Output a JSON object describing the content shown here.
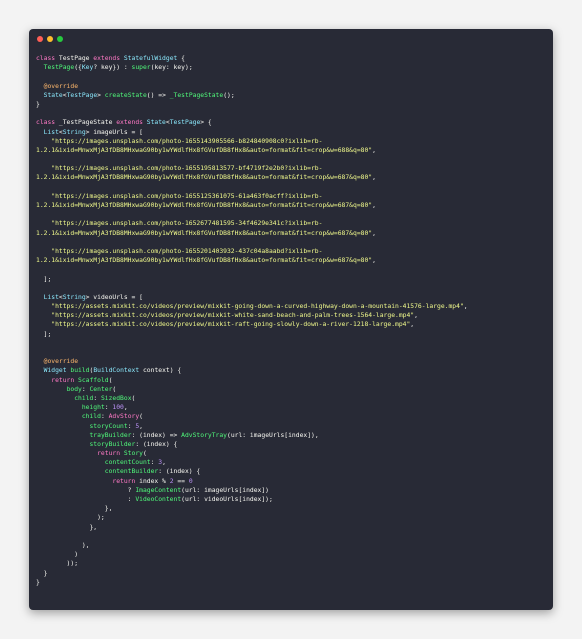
{
  "window": {
    "colors": {
      "background": "#282a36",
      "close": "#ff5f56",
      "minimize": "#ffbd2e",
      "maximize": "#27c93f"
    },
    "syntax_colors": {
      "keyword": "#ff79c6",
      "type": "#8be9fd",
      "function": "#50fa7b",
      "string": "#f1fa8c",
      "number": "#bd93f9",
      "annotation": "#ffb86c",
      "plain": "#f8f8f2"
    }
  },
  "code": {
    "lines": [
      [
        [
          "kw",
          "class "
        ],
        [
          "pl",
          "TestPage "
        ],
        [
          "kw",
          "extends "
        ],
        [
          "ty",
          "StatefulWidget"
        ],
        [
          "pl",
          " {"
        ]
      ],
      [
        [
          "pl",
          "  "
        ],
        [
          "fn",
          "TestPage"
        ],
        [
          "pl",
          "({"
        ],
        [
          "ty",
          "Key"
        ],
        [
          "pl",
          "? key}) : "
        ],
        [
          "fn",
          "super"
        ],
        [
          "pl",
          "(key: key);"
        ]
      ],
      [
        [
          "pl",
          ""
        ]
      ],
      [
        [
          "pl",
          "  "
        ],
        [
          "an",
          "@override"
        ]
      ],
      [
        [
          "pl",
          "  "
        ],
        [
          "ty",
          "State"
        ],
        [
          "pl",
          "<"
        ],
        [
          "ty",
          "TestPage"
        ],
        [
          "pl",
          "> "
        ],
        [
          "fn",
          "createState"
        ],
        [
          "pl",
          "() => "
        ],
        [
          "fn",
          "_TestPageState"
        ],
        [
          "pl",
          "();"
        ]
      ],
      [
        [
          "pl",
          "}"
        ]
      ],
      [
        [
          "pl",
          ""
        ]
      ],
      [
        [
          "kw",
          "class "
        ],
        [
          "pl",
          "_TestPageState "
        ],
        [
          "kw",
          "extends "
        ],
        [
          "ty",
          "State"
        ],
        [
          "pl",
          "<"
        ],
        [
          "ty",
          "TestPage"
        ],
        [
          "pl",
          "> {"
        ]
      ],
      [
        [
          "pl",
          "  "
        ],
        [
          "ty",
          "List"
        ],
        [
          "pl",
          "<"
        ],
        [
          "ty",
          "String"
        ],
        [
          "pl",
          "> imageUrls = ["
        ]
      ],
      [
        [
          "pl",
          "    "
        ],
        [
          "st",
          "\"https://images.unsplash.com/photo-1655143905566-b824840908c0?ixlib=rb-"
        ]
      ],
      [
        [
          "st",
          "1.2.1&ixid=MnwxMjA3fDB8MHxwaG90by1wYWdlfHx8fGVufDB8fHx8&auto=format&fit=crop&w=688&q=80\""
        ],
        [
          "pl",
          ","
        ]
      ],
      [
        [
          "pl",
          ""
        ]
      ],
      [
        [
          "pl",
          "    "
        ],
        [
          "st",
          "\"https://images.unsplash.com/photo-1655195813577-bf4719f2e2b0?ixlib=rb-"
        ]
      ],
      [
        [
          "st",
          "1.2.1&ixid=MnwxMjA3fDB8MHxwaG90by1wYWdlfHx8fGVufDB8fHx8&auto=format&fit=crop&w=687&q=80\""
        ],
        [
          "pl",
          ","
        ]
      ],
      [
        [
          "pl",
          ""
        ]
      ],
      [
        [
          "pl",
          "    "
        ],
        [
          "st",
          "\"https://images.unsplash.com/photo-1655125361075-61a463f0acff?ixlib=rb-"
        ]
      ],
      [
        [
          "st",
          "1.2.1&ixid=MnwxMjA3fDB8MHxwaG90by1wYWdlfHx8fGVufDB8fHx8&auto=format&fit=crop&w=687&q=80\""
        ],
        [
          "pl",
          ","
        ]
      ],
      [
        [
          "pl",
          ""
        ]
      ],
      [
        [
          "pl",
          "    "
        ],
        [
          "st",
          "\"https://images.unsplash.com/photo-1652677481595-34f4629e341c?ixlib=rb-"
        ]
      ],
      [
        [
          "st",
          "1.2.1&ixid=MnwxMjA3fDB8MHxwaG90by1wYWdlfHx8fGVufDB8fHx8&auto=format&fit=crop&w=687&q=80\""
        ],
        [
          "pl",
          ","
        ]
      ],
      [
        [
          "pl",
          ""
        ]
      ],
      [
        [
          "pl",
          "    "
        ],
        [
          "st",
          "\"https://images.unsplash.com/photo-1655201403932-437c04a8aabd?ixlib=rb-"
        ]
      ],
      [
        [
          "st",
          "1.2.1&ixid=MnwxMjA3fDB8MHxwaG90by1wYWdlfHx8fGVufDB8fHx8&auto=format&fit=crop&w=687&q=80\""
        ],
        [
          "pl",
          ","
        ]
      ],
      [
        [
          "pl",
          ""
        ]
      ],
      [
        [
          "pl",
          "  ];"
        ]
      ],
      [
        [
          "pl",
          ""
        ]
      ],
      [
        [
          "pl",
          "  "
        ],
        [
          "ty",
          "List"
        ],
        [
          "pl",
          "<"
        ],
        [
          "ty",
          "String"
        ],
        [
          "pl",
          "> videoUrls = ["
        ]
      ],
      [
        [
          "pl",
          "    "
        ],
        [
          "st",
          "\"https://assets.mixkit.co/videos/preview/mixkit-going-down-a-curved-highway-down-a-mountain-41576-large.mp4\""
        ],
        [
          "pl",
          ","
        ]
      ],
      [
        [
          "pl",
          "    "
        ],
        [
          "st",
          "\"https://assets.mixkit.co/videos/preview/mixkit-white-sand-beach-and-palm-trees-1564-large.mp4\""
        ],
        [
          "pl",
          ","
        ]
      ],
      [
        [
          "pl",
          "    "
        ],
        [
          "st",
          "\"https://assets.mixkit.co/videos/preview/mixkit-raft-going-slowly-down-a-river-1218-large.mp4\""
        ],
        [
          "pl",
          ","
        ]
      ],
      [
        [
          "pl",
          "  ];"
        ]
      ],
      [
        [
          "pl",
          ""
        ]
      ],
      [
        [
          "pl",
          ""
        ]
      ],
      [
        [
          "pl",
          "  "
        ],
        [
          "an",
          "@override"
        ]
      ],
      [
        [
          "pl",
          "  "
        ],
        [
          "ty",
          "Widget "
        ],
        [
          "fn",
          "build"
        ],
        [
          "pl",
          "("
        ],
        [
          "ty",
          "BuildContext"
        ],
        [
          "pl",
          " context) {"
        ]
      ],
      [
        [
          "pl",
          "    "
        ],
        [
          "kw",
          "return "
        ],
        [
          "fn",
          "Scaffold"
        ],
        [
          "pl",
          "("
        ]
      ],
      [
        [
          "pl",
          "        "
        ],
        [
          "fn",
          "body"
        ],
        [
          "pl",
          ": "
        ],
        [
          "fn",
          "Center"
        ],
        [
          "pl",
          "("
        ]
      ],
      [
        [
          "pl",
          "          "
        ],
        [
          "fn",
          "child"
        ],
        [
          "pl",
          ": "
        ],
        [
          "fn",
          "SizedBox"
        ],
        [
          "pl",
          "("
        ]
      ],
      [
        [
          "pl",
          "            "
        ],
        [
          "fn",
          "height"
        ],
        [
          "pl",
          ": "
        ],
        [
          "nu",
          "100"
        ],
        [
          "pl",
          ","
        ]
      ],
      [
        [
          "pl",
          "            "
        ],
        [
          "fn",
          "child"
        ],
        [
          "pl",
          ": "
        ],
        [
          "kw",
          "AdvStory"
        ],
        [
          "pl",
          "("
        ]
      ],
      [
        [
          "pl",
          "              "
        ],
        [
          "fn",
          "storyCount"
        ],
        [
          "pl",
          ": "
        ],
        [
          "nu",
          "5"
        ],
        [
          "pl",
          ","
        ]
      ],
      [
        [
          "pl",
          "              "
        ],
        [
          "fn",
          "trayBuilder"
        ],
        [
          "pl",
          ": (index) => "
        ],
        [
          "fn",
          "AdvStoryTray"
        ],
        [
          "pl",
          "(url: imageUrls[index]),"
        ]
      ],
      [
        [
          "pl",
          "              "
        ],
        [
          "fn",
          "storyBuilder"
        ],
        [
          "pl",
          ": (index) {"
        ]
      ],
      [
        [
          "pl",
          "                "
        ],
        [
          "kw",
          "return "
        ],
        [
          "fn",
          "Story"
        ],
        [
          "pl",
          "("
        ]
      ],
      [
        [
          "pl",
          "                  "
        ],
        [
          "fn",
          "contentCount"
        ],
        [
          "pl",
          ": "
        ],
        [
          "nu",
          "3"
        ],
        [
          "pl",
          ","
        ]
      ],
      [
        [
          "pl",
          "                  "
        ],
        [
          "fn",
          "contentBuilder"
        ],
        [
          "pl",
          ": (index) {"
        ]
      ],
      [
        [
          "pl",
          "                    "
        ],
        [
          "kw",
          "return "
        ],
        [
          "pl",
          "index % "
        ],
        [
          "nu",
          "2"
        ],
        [
          "pl",
          " == "
        ],
        [
          "nu",
          "0"
        ]
      ],
      [
        [
          "pl",
          "                        ? "
        ],
        [
          "fn",
          "ImageContent"
        ],
        [
          "pl",
          "(url: imageUrls[index])"
        ]
      ],
      [
        [
          "pl",
          "                        : "
        ],
        [
          "fn",
          "VideoContent"
        ],
        [
          "pl",
          "(url: videoUrls[index]);"
        ]
      ],
      [
        [
          "pl",
          "                  },"
        ]
      ],
      [
        [
          "pl",
          "                );"
        ]
      ],
      [
        [
          "pl",
          "              },"
        ]
      ],
      [
        [
          "pl",
          ""
        ]
      ],
      [
        [
          "pl",
          "            ),"
        ]
      ],
      [
        [
          "pl",
          "          )"
        ]
      ],
      [
        [
          "pl",
          "        ));"
        ]
      ],
      [
        [
          "pl",
          "  }"
        ]
      ],
      [
        [
          "pl",
          "}"
        ]
      ]
    ]
  }
}
